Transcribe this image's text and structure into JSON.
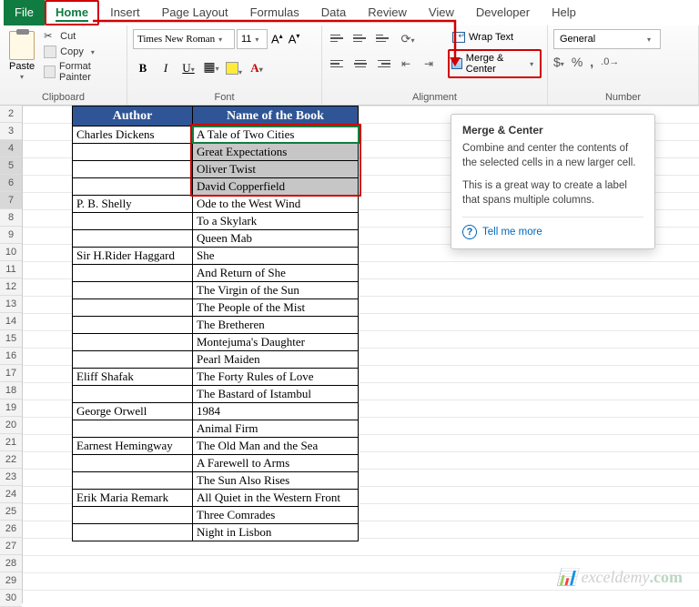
{
  "tabs": [
    "File",
    "Home",
    "Insert",
    "Page Layout",
    "Formulas",
    "Data",
    "Review",
    "View",
    "Developer",
    "Help"
  ],
  "activeTab": "Home",
  "ribbon": {
    "clipboard": {
      "label": "Clipboard",
      "paste": "Paste",
      "cut": "Cut",
      "copy": "Copy",
      "painter": "Format Painter"
    },
    "font": {
      "label": "Font",
      "name": "Times New Roman",
      "size": "11"
    },
    "alignment": {
      "label": "Alignment",
      "wrap": "Wrap Text",
      "merge": "Merge & Center"
    },
    "number": {
      "label": "Number",
      "format": "General"
    }
  },
  "table": {
    "headerA": "Author",
    "headerB": "Name of the Book",
    "rows": [
      {
        "a": "Charles Dickens",
        "b": "A Tale of Two Cities"
      },
      {
        "a": "",
        "b": "Great Expectations"
      },
      {
        "a": "",
        "b": "Oliver Twist"
      },
      {
        "a": "",
        "b": "David Copperfield"
      },
      {
        "a": "P. B. Shelly",
        "b": "Ode to the West Wind"
      },
      {
        "a": "",
        "b": "To a Skylark"
      },
      {
        "a": "",
        "b": "Queen Mab"
      },
      {
        "a": "Sir H.Rider Haggard",
        "b": "She"
      },
      {
        "a": "",
        "b": "And Return of She"
      },
      {
        "a": "",
        "b": "The Virgin of the Sun"
      },
      {
        "a": "",
        "b": "The People of the Mist"
      },
      {
        "a": "",
        "b": "The Bretheren"
      },
      {
        "a": "",
        "b": "Montejuma's Daughter"
      },
      {
        "a": "",
        "b": "Pearl Maiden"
      },
      {
        "a": "Eliff Shafak",
        "b": "The Forty Rules of Love"
      },
      {
        "a": "",
        "b": "The Bastard of Istambul"
      },
      {
        "a": "George Orwell",
        "b": "1984"
      },
      {
        "a": "",
        "b": "Animal Firm"
      },
      {
        "a": "Earnest Hemingway",
        "b": "The Old Man and the Sea"
      },
      {
        "a": "",
        "b": "A Farewell to Arms"
      },
      {
        "a": "",
        "b": "The Sun Also Rises"
      },
      {
        "a": "Erik Maria Remark",
        "b": "All Quiet in the Western Front"
      },
      {
        "a": "",
        "b": "Three Comrades"
      },
      {
        "a": "",
        "b": "Night in Lisbon"
      }
    ]
  },
  "rowNumbers": [
    2,
    3,
    4,
    5,
    6,
    7,
    8,
    9,
    10,
    11,
    12,
    13,
    14,
    15,
    16,
    17,
    18,
    19,
    20,
    21,
    22,
    23,
    24,
    25,
    26,
    27,
    28,
    29,
    30
  ],
  "selectedRowNumbers": [
    4,
    5,
    6,
    7
  ],
  "tooltip": {
    "title": "Merge & Center",
    "p1": "Combine and center the contents of the selected cells in a new larger cell.",
    "p2": "This is a great way to create a label that spans multiple columns.",
    "tell": "Tell me more"
  },
  "watermark": "exceldemy"
}
